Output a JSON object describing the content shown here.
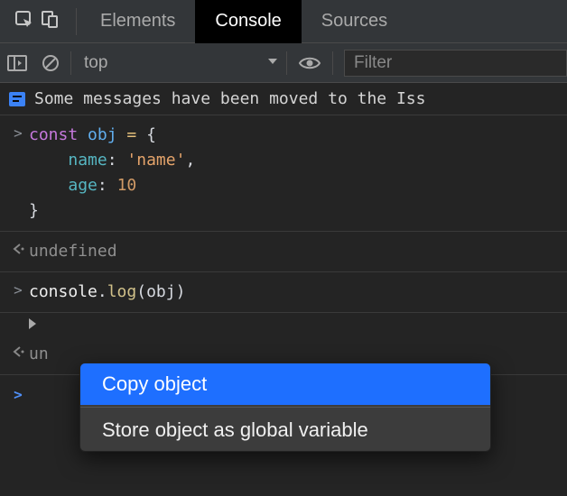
{
  "tabs": {
    "elements": "Elements",
    "console": "Console",
    "sources": "Sources",
    "active": "Console"
  },
  "toolbar": {
    "context": "top",
    "filter_placeholder": "Filter"
  },
  "banner": {
    "text": "Some messages have been moved to the Iss"
  },
  "console": {
    "input1": {
      "kw": "const",
      "var": "obj",
      "eq": "=",
      "brace_open": "{",
      "prop_name": "name",
      "colon1": ":",
      "val_name": "'name'",
      "comma": ",",
      "prop_age": "age",
      "colon2": ":",
      "val_age": "10",
      "brace_close": "}"
    },
    "ret_undefined": "undefined",
    "input2": {
      "obj": "console",
      "dot": ".",
      "fn": "log",
      "open": "(",
      "arg": "obj",
      "close": ")"
    },
    "ret_undefined2_prefix": "un"
  },
  "context_menu": {
    "copy": "Copy object",
    "store": "Store object as global variable"
  }
}
